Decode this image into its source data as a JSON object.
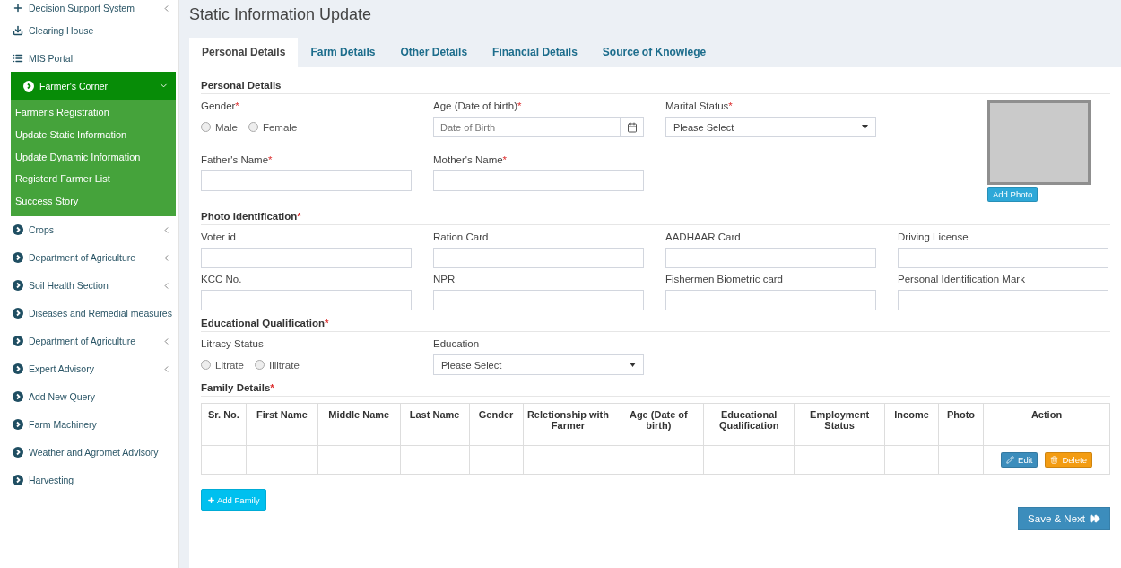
{
  "sidebar": {
    "items": [
      {
        "label": "Decision Support System",
        "kind": "plus",
        "expanded": false
      },
      {
        "label": "Clearing House",
        "kind": "download"
      },
      {
        "label": "MIS Portal",
        "kind": "list"
      },
      {
        "label": "Farmer's Corner",
        "kind": "circle",
        "expanded": true,
        "children": [
          {
            "label": "Farmer's Registration"
          },
          {
            "label": "Update Static Information"
          },
          {
            "label": "Update Dynamic Information"
          },
          {
            "label": "Registerd Farmer List"
          },
          {
            "label": "Success Story"
          }
        ]
      },
      {
        "label": "Crops",
        "kind": "circle",
        "expanded": false
      },
      {
        "label": "Department of Agriculture",
        "kind": "circle",
        "expanded": false
      },
      {
        "label": "Soil Health Section",
        "kind": "circle",
        "expanded": false
      },
      {
        "label": "Diseases and Remedial measures",
        "kind": "circle"
      },
      {
        "label": "Department of Agriculture",
        "kind": "circle",
        "expanded": false
      },
      {
        "label": "Expert Advisory",
        "kind": "circle",
        "expanded": false
      },
      {
        "label": "Add New Query",
        "kind": "circle"
      },
      {
        "label": "Farm Machinery",
        "kind": "circle"
      },
      {
        "label": "Weather and Agromet Advisory",
        "kind": "circle"
      },
      {
        "label": "Harvesting",
        "kind": "circle"
      }
    ]
  },
  "page_title": "Static Information Update",
  "tabs": [
    {
      "label": "Personal Details",
      "selected": true
    },
    {
      "label": "Farm Details",
      "selected": false
    },
    {
      "label": "Other Details",
      "selected": false
    },
    {
      "label": "Financial Details",
      "selected": false
    },
    {
      "label": "Source of Knowlege",
      "selected": false
    }
  ],
  "personal_details": {
    "heading": "Personal Details",
    "gender": {
      "label": "Gender",
      "mark": "*",
      "options": [
        {
          "label": "Male",
          "selected": false
        },
        {
          "label": "Female",
          "selected": false
        }
      ]
    },
    "dob": {
      "label": "Age (Date of birth)",
      "mark": "*",
      "placeholder": "Date of Birth"
    },
    "marital_status": {
      "label": "Marital Status",
      "mark": "*",
      "value": "Please Select"
    },
    "father_name": {
      "label": "Father's Name",
      "mark": "*"
    },
    "mother_name": {
      "label": "Mother's Name",
      "mark": "*"
    },
    "add_photo": "Add Photo"
  },
  "photo_identification": {
    "heading": "Photo Identification",
    "mark": "*",
    "fields": [
      {
        "label": "Voter id"
      },
      {
        "label": "Ration Card"
      },
      {
        "label": "AADHAAR Card"
      },
      {
        "label": "Driving License"
      },
      {
        "label": "KCC No."
      },
      {
        "label": "NPR"
      },
      {
        "label": "Fishermen Biometric card"
      },
      {
        "label": "Personal Identification Mark"
      }
    ]
  },
  "education": {
    "heading": "Educational Qualification",
    "mark": "*",
    "literacy": {
      "label": "Litracy Status",
      "options": [
        {
          "label": "Litrate",
          "selected": false
        },
        {
          "label": "Illitrate",
          "selected": false
        }
      ]
    },
    "education": {
      "label": "Education",
      "value": "Please Select"
    }
  },
  "family": {
    "heading": "Family Details",
    "mark": "*",
    "columns": [
      "Sr. No.",
      "First Name",
      "Middle Name",
      "Last Name",
      "Gender",
      "Reletionship with Farmer",
      "Age (Date of birth)",
      "Educational Qualification",
      "Employment Status",
      "Income",
      "Photo",
      "Action"
    ],
    "rows": [
      {
        "edit": "Edit",
        "delete": "Delete"
      }
    ]
  },
  "add_family": "Add Family",
  "save_next": "Save & Next"
}
